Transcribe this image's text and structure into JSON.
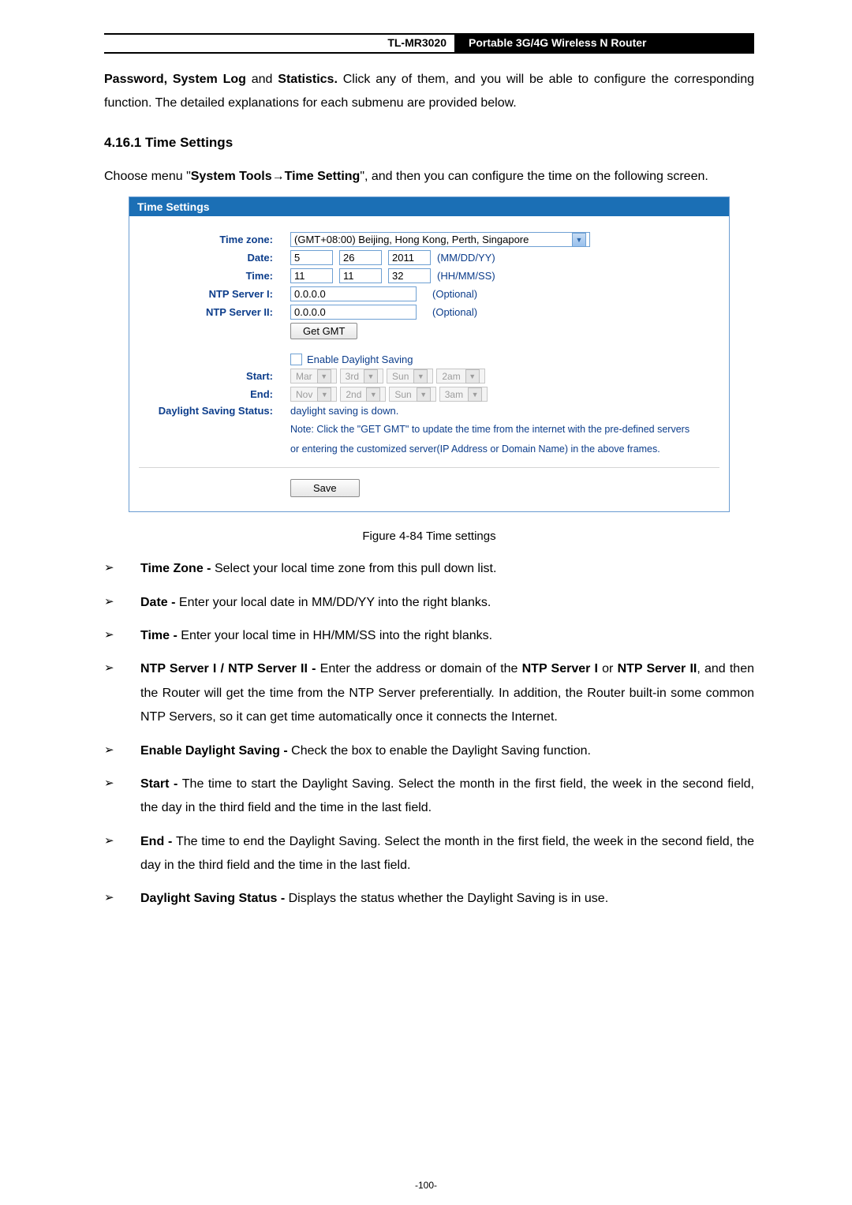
{
  "header_band": {
    "model": "TL-MR3020",
    "title": "Portable 3G/4G Wireless N Router"
  },
  "intro1": {
    "p1a": "Password, System Log",
    "p1b": " and ",
    "p1c": "Statistics.",
    "p1d": " Click any of them, and you will be able to configure the corresponding function. The detailed explanations for each submenu are provided below."
  },
  "section_title": "4.16.1  Time Settings",
  "intro2": {
    "a": "Choose menu \"",
    "b": "System Tools",
    "c": "→",
    "d": "Time Setting",
    "e": "\", and then you can configure the time on the following screen."
  },
  "shot": {
    "title": "Time Settings",
    "labels": {
      "tz": "Time zone:",
      "date": "Date:",
      "time": "Time:",
      "ntp1": "NTP Server I:",
      "ntp2": "NTP Server II:",
      "start": "Start:",
      "end": "End:",
      "dss": "Daylight Saving Status:"
    },
    "tz_value": "(GMT+08:00) Beijing, Hong Kong, Perth, Singapore",
    "date": {
      "m": "5",
      "d": "26",
      "y": "2011",
      "hint": "(MM/DD/YY)"
    },
    "time": {
      "h": "11",
      "min": "11",
      "s": "32",
      "hint": "(HH/MM/SS)"
    },
    "ntp1": "0.0.0.0",
    "ntp2": "0.0.0.0",
    "optional": "(Optional)",
    "get_gmt": "Get GMT",
    "enable_ds": "Enable Daylight Saving",
    "start": [
      "Mar",
      "3rd",
      "Sun",
      "2am"
    ],
    "end": [
      "Nov",
      "2nd",
      "Sun",
      "3am"
    ],
    "dss_val": "daylight saving is down.",
    "note1": "Note: Click the \"GET GMT\" to update the time from the internet with the pre-defined servers",
    "note2": "or entering the customized server(IP Address or Domain Name) in the above frames.",
    "save": "Save"
  },
  "figure_caption": "Figure 4-84    Time settings",
  "bullets": {
    "b1a": "Time Zone - ",
    "b1b": "Select your local time zone from this pull down list.",
    "b2a": "Date - ",
    "b2b": "Enter your local date in MM/DD/YY into the right blanks.",
    "b3a": "Time - ",
    "b3b": "Enter your local time in HH/MM/SS into the right blanks.",
    "b4a": "NTP Server I / NTP Server II - ",
    "b4b": "Enter the address or domain of the ",
    "b4c": "NTP Server I",
    "b4d": " or ",
    "b4e": "NTP Server II",
    "b4f": ", and then the Router will get the time from the NTP Server preferentially. In addition, the Router built-in some common NTP Servers, so it can get time automatically once it connects the Internet.",
    "b5a": "Enable Daylight Saving - ",
    "b5b": "Check the box to enable the Daylight Saving function.",
    "b6a": "Start - ",
    "b6b": "The time to start the Daylight Saving. Select the month in the first field, the week in the second field, the day in the third field and the time in the last field.",
    "b7a": "End - ",
    "b7b": "The time to end the Daylight Saving. Select the month in the first field, the week in the second field, the day in the third field and the time in the last field.",
    "b8a": "Daylight Saving Status - ",
    "b8b": "Displays the status whether the Daylight Saving is in use."
  },
  "page_number": "-100-"
}
